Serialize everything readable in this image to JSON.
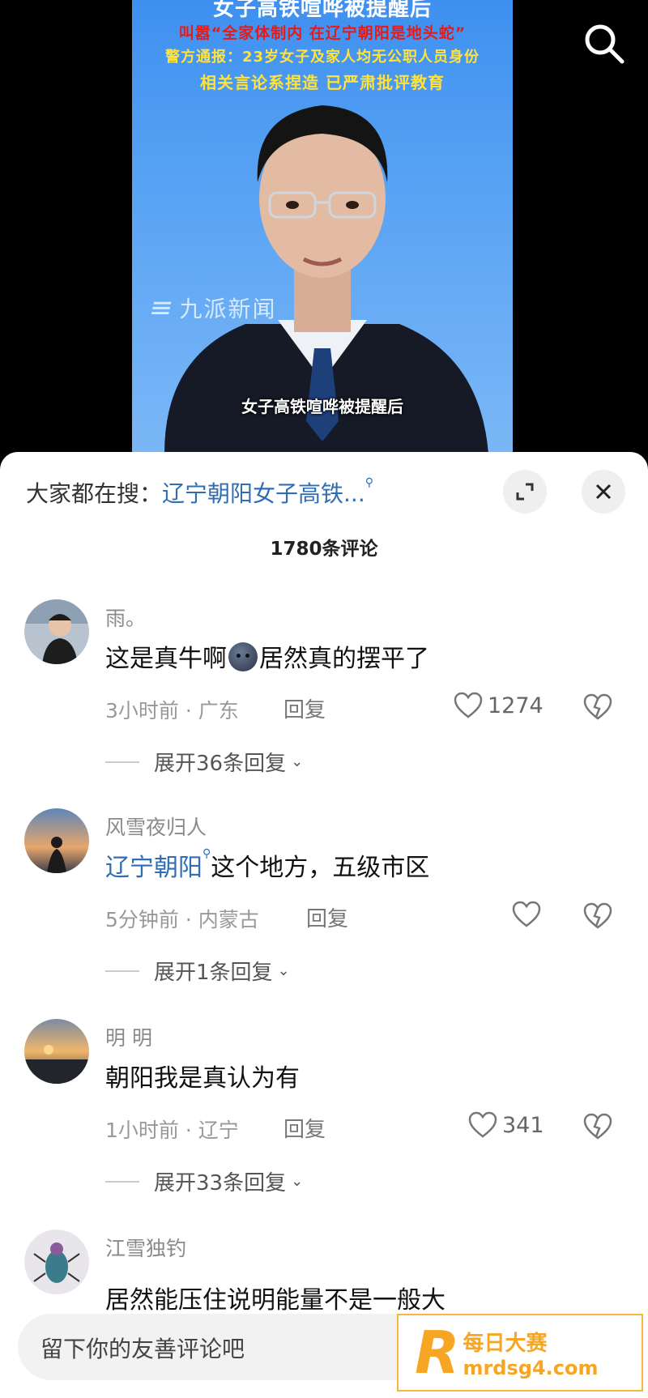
{
  "video": {
    "headline_top": "女子高铁喧哗被提醒后",
    "headline_red": "叫嚣“全家体制内 在辽宁朝阳是地头蛇”",
    "headline_police": "警方通报：23岁女子及家人均无公职人员身份",
    "headline_result": "相关言论系捏造 已严肃批评教育",
    "watermark": "九派新闻",
    "subtitle": "女子高铁喧哗被提醒后",
    "search_icon": "search-icon"
  },
  "panel": {
    "search_prefix": "大家都在搜：",
    "search_link": "辽宁朝阳女子高铁...",
    "comment_count": "1780条评论",
    "expand_icon": "expand-icon",
    "close_icon": "close-icon"
  },
  "comments": [
    {
      "username": "雨。",
      "text_before": "这是真牛啊",
      "text_after": "居然真的摆平了",
      "time_location": "3小时前 · 广东",
      "reply": "回复",
      "likes": "1274",
      "expand_replies": "展开36条回复"
    },
    {
      "username": "风雪夜归人",
      "text_link": "辽宁朝阳",
      "text": "这个地方，五级市区",
      "time_location": "5分钟前 · 内蒙古",
      "reply": "回复",
      "likes": "",
      "expand_replies": "展开1条回复"
    },
    {
      "username": "明 明",
      "text": "朝阳我是真认为有",
      "time_location": "1小时前 · 辽宁",
      "reply": "回复",
      "likes": "341",
      "expand_replies": "展开33条回复"
    },
    {
      "username": "江雪独钓",
      "text": "居然能压住说明能量不是一般大"
    }
  ],
  "input": {
    "placeholder": "留下你的友善评论吧"
  },
  "badge": {
    "line1": "每日大赛",
    "line2": "mrdsg4.com"
  },
  "colors": {
    "link": "#2f6db5",
    "video_bg": "#4a98f2",
    "badge": "#f6a623"
  }
}
